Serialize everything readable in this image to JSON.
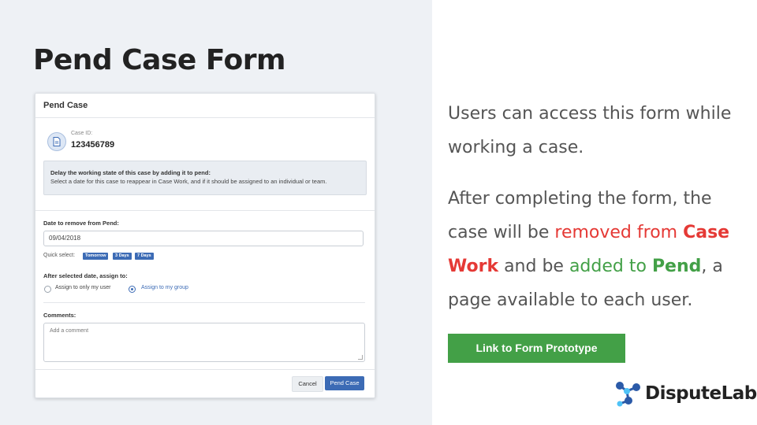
{
  "slide": {
    "title": "Pend Case Form",
    "description_1": "Users can access this form while working a case.",
    "description_2_parts": {
      "p1": "After completing the form, the case will be ",
      "red_text": "removed from ",
      "red_bold": "Case Work",
      "p2": " and be ",
      "green_text": "added to ",
      "green_bold": "Pend",
      "p3": ", a page available to each user."
    },
    "cta_label": "Link to Form Prototype",
    "logo_text": "DisputeLab",
    "colors": {
      "accent_red": "#e53935",
      "accent_green": "#43a047",
      "form_blue": "#3c6bb5"
    }
  },
  "form": {
    "title": "Pend Case",
    "case_id_label": "Case ID:",
    "case_id_value": "123456789",
    "info_title": "Delay the working state of this case by adding it to pend:",
    "info_text": "Select a date for this case to reappear in Case Work, and if it should be assigned to an individual or team.",
    "date_label": "Date to remove from Pend:",
    "date_value": "09/04/2018",
    "quick_select_label": "Quick select:",
    "quick_options": [
      "Tomorrow",
      "3 Days",
      "7 Days"
    ],
    "assign_label": "After selected date, assign to:",
    "assign_options": [
      {
        "label": "Assign to only my user",
        "selected": false
      },
      {
        "label": "Assign to my group",
        "selected": true
      }
    ],
    "comments_label": "Comments:",
    "comments_placeholder": "Add a comment",
    "cancel_label": "Cancel",
    "submit_label": "Pend Case"
  }
}
